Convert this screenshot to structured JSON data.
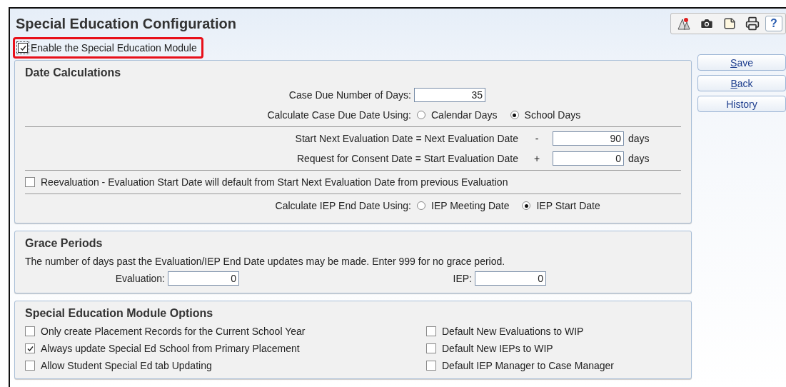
{
  "title": "Special Education Configuration",
  "toolbar": [
    {
      "kind": "map"
    },
    {
      "kind": "camera"
    },
    {
      "kind": "note"
    },
    {
      "kind": "print"
    },
    {
      "kind": "help",
      "label": "?"
    }
  ],
  "enable_module": {
    "label": "Enable the Special Education Module",
    "checked": true,
    "highlighted": true
  },
  "actions": [
    {
      "label": "Save",
      "access_key": true
    },
    {
      "label": "Back",
      "access_key": true
    },
    {
      "label": "History",
      "access_key": false
    }
  ],
  "date_calculations": {
    "title": "Date Calculations",
    "rows": [
      {
        "kind": "input",
        "label": "Case Due Number of Days:",
        "value": "35"
      },
      {
        "kind": "radio",
        "label": "Calculate Case Due Date Using:",
        "options": [
          {
            "label": "Calendar Days",
            "selected": false
          },
          {
            "label": "School Days",
            "selected": true
          }
        ]
      },
      {
        "kind": "divider"
      },
      {
        "kind": "equation",
        "label": "Start Next Evaluation Date = Next Evaluation Date",
        "operator": "-",
        "value": "90",
        "unit": "days"
      },
      {
        "kind": "equation",
        "label": "Request for Consent Date = Start Evaluation Date",
        "operator": "+",
        "value": "0",
        "unit": "days"
      },
      {
        "kind": "divider"
      },
      {
        "kind": "checkbox",
        "label": "Reevaluation - Evaluation Start Date will default from Start Next Evaluation Date from previous Evaluation",
        "checked": false
      },
      {
        "kind": "divider"
      },
      {
        "kind": "radio",
        "label": "Calculate IEP End Date Using:",
        "options": [
          {
            "label": "IEP Meeting Date",
            "selected": false
          },
          {
            "label": "IEP Start Date",
            "selected": true
          }
        ]
      }
    ]
  },
  "grace_periods": {
    "title": "Grace Periods",
    "description": "The number of days past the Evaluation/IEP End Date updates may be made. Enter 999 for no grace period.",
    "fields": [
      {
        "label": "Evaluation:",
        "value": "0"
      },
      {
        "label": "IEP:",
        "value": "0"
      }
    ]
  },
  "module_options": {
    "title": "Special Education Module Options",
    "columns": [
      [
        {
          "label": "Only create Placement Records for the Current School Year",
          "checked": false
        },
        {
          "label": "Always update Special Ed School from Primary Placement",
          "checked": true
        },
        {
          "label": "Allow Student Special Ed tab Updating",
          "checked": false
        }
      ],
      [
        {
          "label": "Default New Evaluations to WIP",
          "checked": false
        },
        {
          "label": "Default New IEPs to WIP",
          "checked": false
        },
        {
          "label": "Default IEP Manager to Case Manager",
          "checked": false
        }
      ]
    ]
  }
}
